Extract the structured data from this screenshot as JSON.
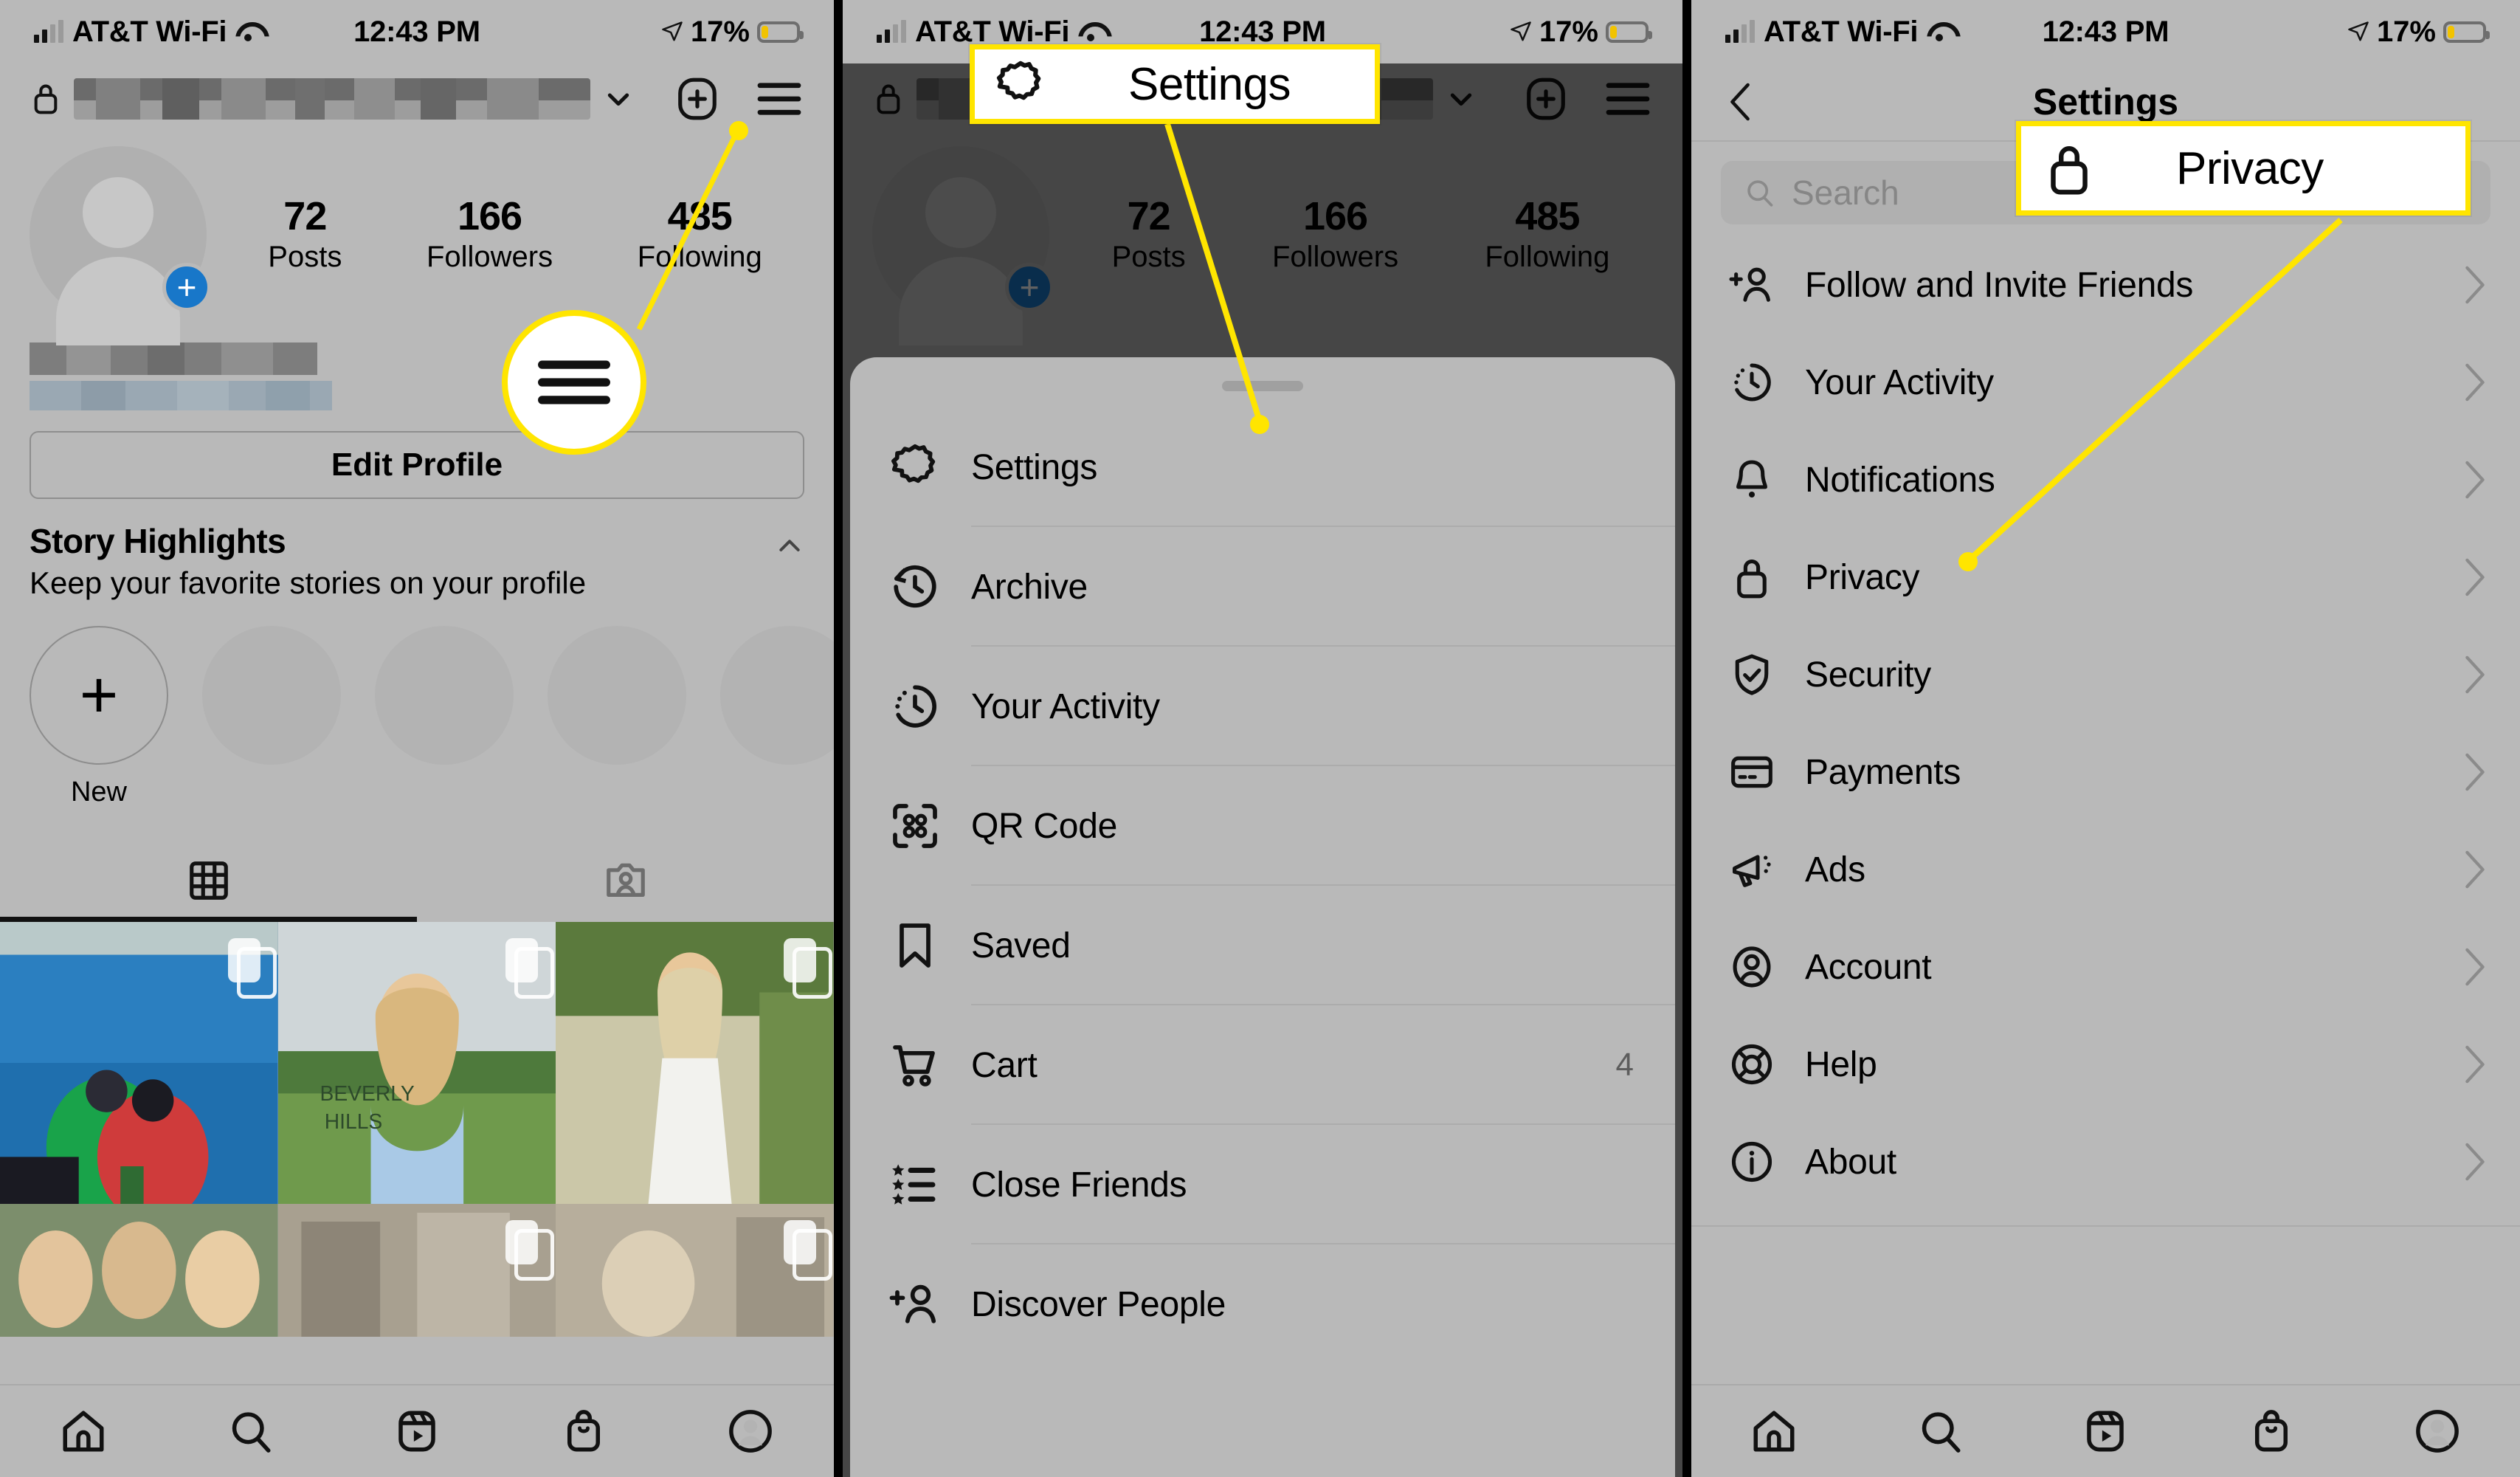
{
  "status_bar": {
    "carrier": "AT&T Wi-Fi",
    "time": "12:43 PM",
    "battery_percent": "17%"
  },
  "panel1": {
    "name": "instagram-profile-screen",
    "header": {
      "lock_icon": "lock-icon",
      "username_redacted": "",
      "chevron_icon": "chevron-down-icon",
      "add_icon": "plus-square-icon",
      "menu_icon": "hamburger-menu-icon"
    },
    "stats": [
      {
        "number": "72",
        "label": "Posts"
      },
      {
        "number": "166",
        "label": "Followers"
      },
      {
        "number": "485",
        "label": "Following"
      }
    ],
    "edit_profile_label": "Edit Profile",
    "story_highlights": {
      "title": "Story Highlights",
      "subtitle": "Keep your favorite stories on your profile",
      "new_label": "New",
      "collapse_icon": "chevron-up-icon"
    },
    "tabs": [
      {
        "name": "grid-tab",
        "icon": "grid-icon",
        "active": true
      },
      {
        "name": "tagged-tab",
        "icon": "tagged-person-icon",
        "active": false
      }
    ],
    "bottom_nav": [
      "home-icon",
      "search-icon",
      "reels-icon",
      "shop-icon",
      "profile-avatar-icon"
    ],
    "highlight": {
      "icon": "hamburger-menu-icon"
    }
  },
  "panel2": {
    "name": "instagram-side-menu-sheet",
    "callout": {
      "icon": "gear-icon",
      "label": "Settings"
    },
    "stats": [
      {
        "number": "72",
        "label": "Posts"
      },
      {
        "number": "166",
        "label": "Followers"
      },
      {
        "number": "485",
        "label": "Following"
      }
    ],
    "menu_items": [
      {
        "icon": "gear-icon",
        "label": "Settings",
        "count": ""
      },
      {
        "icon": "archive-icon",
        "label": "Archive",
        "count": ""
      },
      {
        "icon": "your-activity-icon",
        "label": "Your Activity",
        "count": ""
      },
      {
        "icon": "qr-code-icon",
        "label": "QR Code",
        "count": ""
      },
      {
        "icon": "bookmark-icon",
        "label": "Saved",
        "count": ""
      },
      {
        "icon": "cart-icon",
        "label": "Cart",
        "count": "4"
      },
      {
        "icon": "close-friends-icon",
        "label": "Close Friends",
        "count": ""
      },
      {
        "icon": "discover-people-icon",
        "label": "Discover People",
        "count": ""
      }
    ]
  },
  "panel3": {
    "name": "instagram-settings-screen",
    "back_icon": "chevron-left-icon",
    "title": "Settings",
    "search": {
      "icon": "search-icon",
      "placeholder": "Search",
      "value": ""
    },
    "callout": {
      "icon": "lock-icon",
      "label": "Privacy"
    },
    "items": [
      {
        "icon": "follow-invite-icon",
        "label": "Follow and Invite Friends"
      },
      {
        "icon": "your-activity-icon",
        "label": "Your Activity"
      },
      {
        "icon": "bell-icon",
        "label": "Notifications"
      },
      {
        "icon": "lock-icon",
        "label": "Privacy"
      },
      {
        "icon": "shield-check-icon",
        "label": "Security"
      },
      {
        "icon": "card-icon",
        "label": "Payments"
      },
      {
        "icon": "megaphone-icon",
        "label": "Ads"
      },
      {
        "icon": "account-icon",
        "label": "Account"
      },
      {
        "icon": "help-icon",
        "label": "Help"
      },
      {
        "icon": "info-icon",
        "label": "About"
      }
    ],
    "bottom_nav": [
      "home-icon",
      "search-icon",
      "reels-icon",
      "shop-icon",
      "profile-avatar-icon"
    ]
  },
  "colors": {
    "highlight_yellow": "#ffe500",
    "panel_bg": "#b9b9b9",
    "accent_blue": "#1877c9",
    "battery_yellow": "#f2c300"
  }
}
